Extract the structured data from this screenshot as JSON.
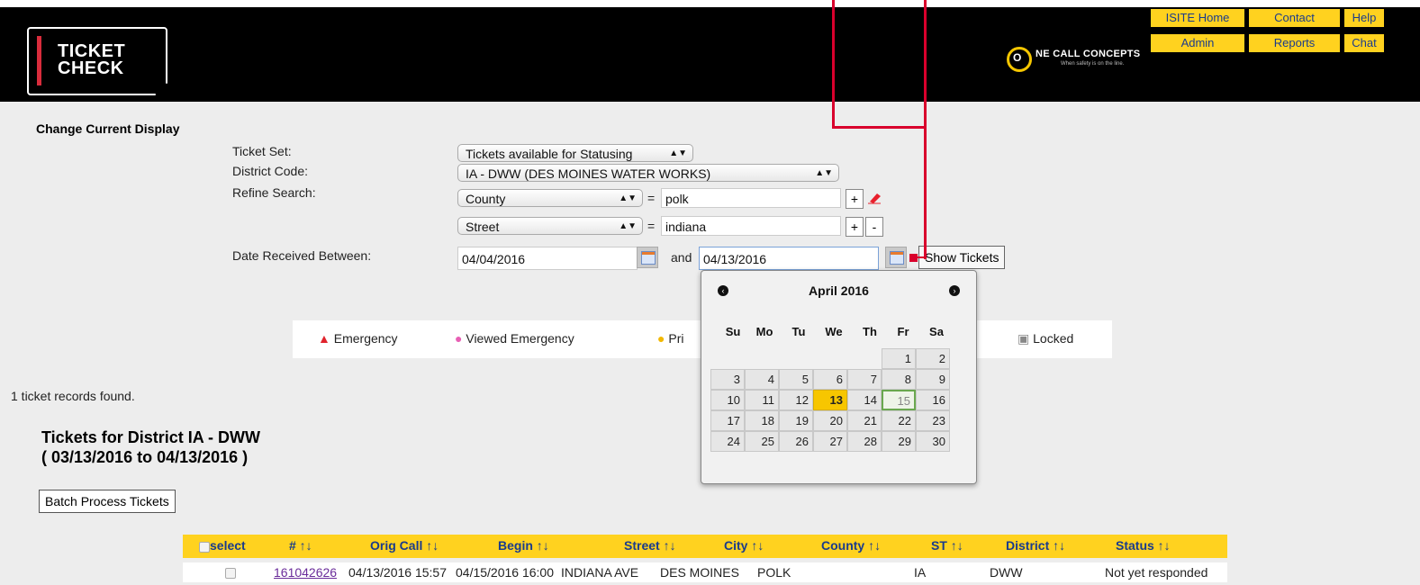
{
  "header": {
    "logo_line1": "TICKET",
    "logo_line2": "CHECK",
    "brand_mark": "O",
    "brand_name": "NE CALL CONCEPTS",
    "brand_tagline": "When safety is on the line.",
    "nav_top": [
      "ISITE Home",
      "Contact",
      "Help"
    ],
    "nav_bottom": [
      "Admin",
      "Reports",
      "Chat"
    ]
  },
  "filter": {
    "title": "Change Current Display",
    "ticket_set_label": "Ticket Set:",
    "ticket_set_value": "Tickets available for Statusing",
    "district_label": "District Code:",
    "district_value": "IA - DWW (DES MOINES WATER WORKS)",
    "refine_label": "Refine Search:",
    "refine1_field": "County",
    "refine1_value": "polk",
    "refine2_field": "Street",
    "refine2_value": "indiana",
    "equals": "=",
    "plus": "+",
    "minus": "-",
    "date_label": "Date Received Between:",
    "date_from": "04/04/2016",
    "and": "and",
    "date_to": "04/13/2016",
    "show_button": "Show Tickets"
  },
  "legend": {
    "emergency": "Emergency",
    "viewed_emergency": "Viewed Emergency",
    "priority_partial": "Pri",
    "locked": "Locked"
  },
  "calendar": {
    "month_label": "April 2016",
    "prev": "‹",
    "next": "›",
    "day_names": [
      "Su",
      "Mo",
      "Tu",
      "We",
      "Th",
      "Fr",
      "Sa"
    ],
    "weeks": [
      [
        "",
        "",
        "",
        "",
        "",
        "1",
        "2"
      ],
      [
        "3",
        "4",
        "5",
        "6",
        "7",
        "8",
        "9"
      ],
      [
        "10",
        "11",
        "12",
        "13",
        "14",
        "15",
        "16"
      ],
      [
        "17",
        "18",
        "19",
        "20",
        "21",
        "22",
        "23"
      ],
      [
        "24",
        "25",
        "26",
        "27",
        "28",
        "29",
        "30"
      ]
    ],
    "today": "13",
    "hovered": "15"
  },
  "results": {
    "count_text": "1 ticket records found.",
    "title_line1": "Tickets for District IA - DWW",
    "title_line2": "( 03/13/2016 to 04/13/2016 )",
    "batch_button": "Batch Process Tickets"
  },
  "table": {
    "headers": [
      "select",
      "# ↑↓",
      "Orig Call ↑↓",
      "Begin ↑↓",
      "Street ↑↓",
      "City ↑↓",
      "County ↑↓",
      "ST ↑↓",
      "District ↑↓",
      "Status ↑↓"
    ],
    "row": [
      "",
      "161042626",
      "04/13/2016 15:57",
      "04/15/2016 16:00",
      "INDIANA AVE",
      "DES MOINES",
      "POLK",
      "IA",
      "DWW",
      "Not yet responded"
    ]
  },
  "colors": {
    "header_bg": "#000000",
    "nav_yellow": "#ffd21f",
    "nav_text": "#1a3b8c",
    "page_bg": "#ededed",
    "accent_red": "#d9002c",
    "today_yellow": "#f7c600",
    "link_purple": "#6a2c9a"
  },
  "icons": [
    "warning-icon",
    "eye-icon",
    "circle-icon",
    "lock-icon",
    "calendar-icon",
    "eraser-icon",
    "hand-cursor-icon"
  ]
}
